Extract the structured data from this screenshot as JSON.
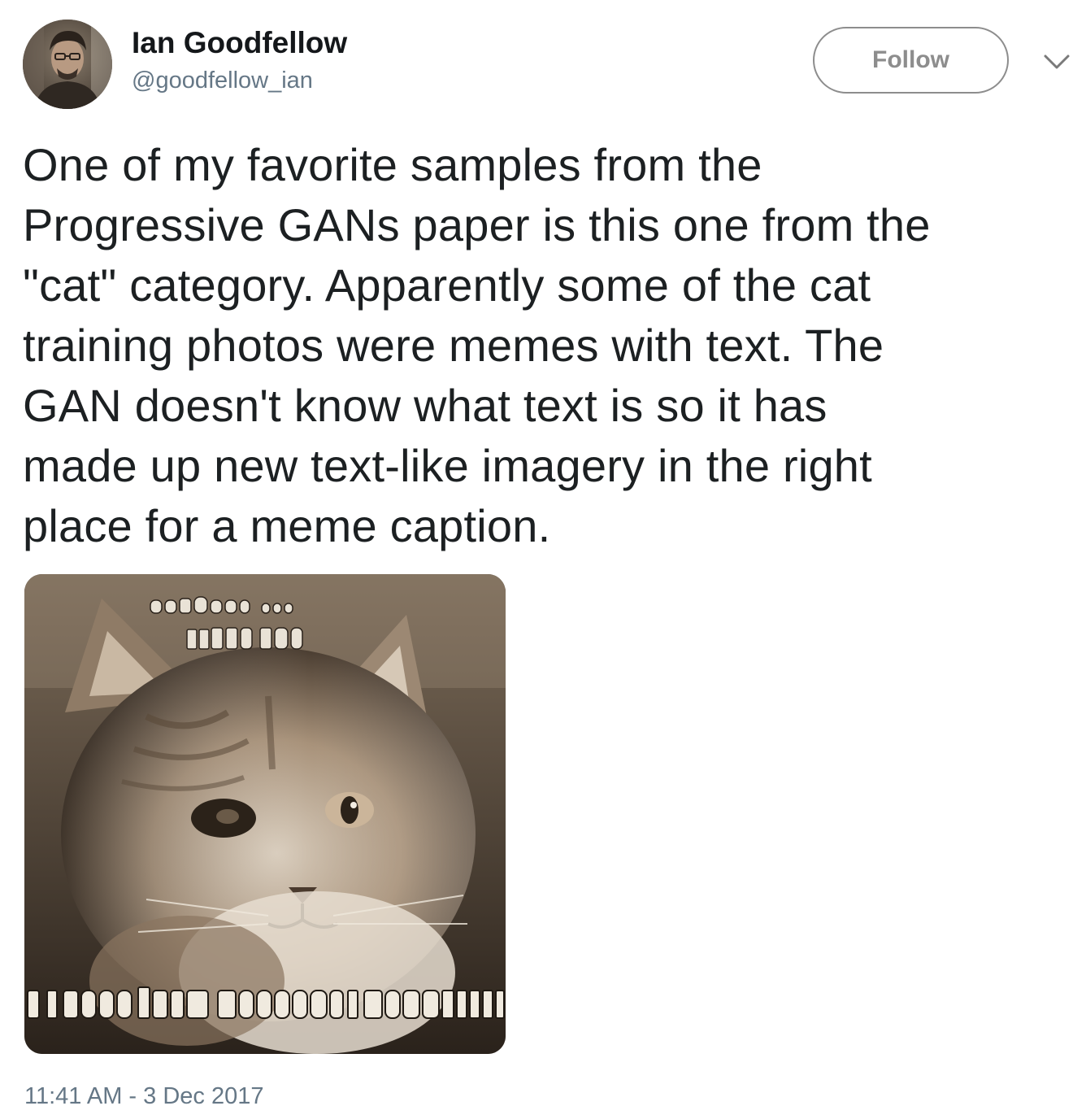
{
  "user": {
    "display_name": "Ian Goodfellow",
    "screen_name": "@goodfellow_ian"
  },
  "actions": {
    "follow_label": "Follow",
    "menu_icon": "chevron-down-icon"
  },
  "tweet": {
    "text": "One of my favorite samples from the\nProgressive GANs paper is this one from the\n\"cat\" category. Apparently some of the cat\ntraining photos were memes with text. The\nGAN doesn't know what text is so it has\nmade up new text-like imagery in the right\nplace for a meme caption.",
    "timestamp": "11:41 AM - 3 Dec 2017"
  },
  "colors": {
    "text": "#1c2022",
    "secondary_text": "#657786",
    "follow_border": "#8d8d8d",
    "photo_tone": "#8a7a68"
  }
}
